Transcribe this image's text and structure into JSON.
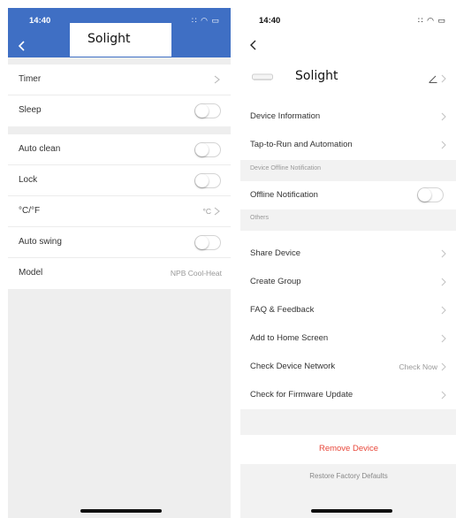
{
  "left": {
    "status_time": "14:40",
    "status_icons": "∷ ◠ ▭",
    "title": "Solight",
    "group1": [
      {
        "label": "Timer",
        "control": "chevron"
      },
      {
        "label": "Sleep",
        "control": "toggle",
        "on": false
      }
    ],
    "group2": [
      {
        "label": "Auto clean",
        "control": "toggle",
        "on": false
      },
      {
        "label": "Lock",
        "control": "toggle",
        "on": false
      },
      {
        "label": "°C/°F",
        "control": "value-chevron",
        "value": "°C"
      },
      {
        "label": "Auto swing",
        "control": "toggle",
        "on": false
      },
      {
        "label": "Model",
        "control": "value",
        "value": "NPB Cool-Heat"
      }
    ],
    "header_color": "#3f6fc4"
  },
  "right": {
    "status_time": "14:40",
    "status_icons": "∷ ◠ ▭",
    "device_name": "Solight",
    "items": {
      "device_information": "Device Information",
      "tap_to_run": "Tap-to-Run and Automation",
      "section_offline": "Device Offline Notification",
      "offline_notification": "Offline Notification",
      "section_others": "Others",
      "share_device": "Share Device",
      "create_group": "Create Group",
      "faq": "FAQ & Feedback",
      "add_home": "Add to Home Screen",
      "check_network": "Check Device Network",
      "check_now": "Check Now",
      "firmware": "Check for Firmware Update"
    },
    "remove_device": "Remove Device",
    "restore_defaults": "Restore Factory Defaults",
    "remove_color": "#e8473a"
  }
}
